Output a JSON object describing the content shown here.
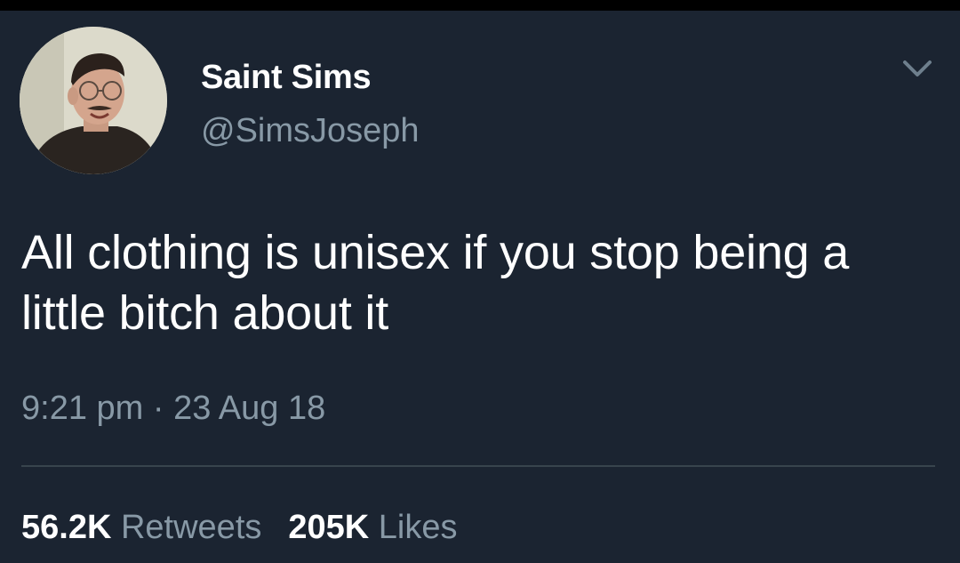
{
  "tweet": {
    "author": {
      "display_name": "Saint Sims",
      "handle": "@SimsJoseph",
      "avatar_icon": "profile-photo"
    },
    "menu_icon": "chevron-down-icon",
    "text": "All clothing is unisex if you stop being a little bitch about it",
    "timestamp": "9:21 pm · 23 Aug 18",
    "stats": {
      "retweets_count": "56.2K",
      "retweets_label": "Retweets",
      "likes_count": "205K",
      "likes_label": "Likes"
    }
  },
  "colors": {
    "background": "#1b2431",
    "text_primary": "#ffffff",
    "text_secondary": "#8899a6",
    "divider": "#38444d"
  }
}
